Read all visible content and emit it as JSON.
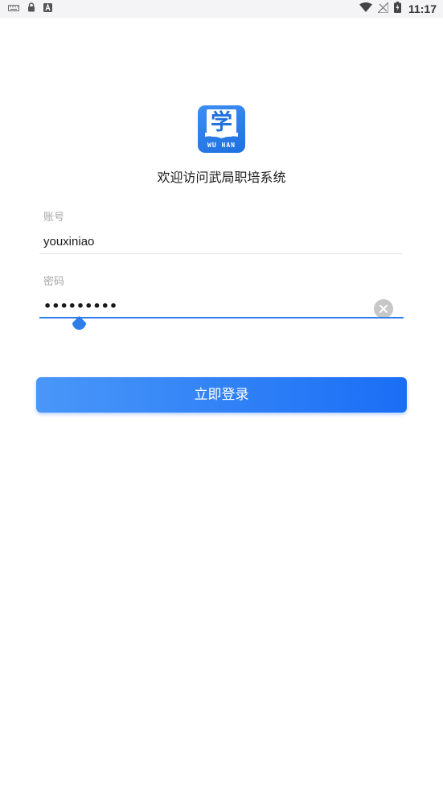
{
  "status_bar": {
    "left_icons": [
      "keyboard-icon",
      "lock-icon",
      "font-a-icon"
    ],
    "right_icons": [
      "wifi-icon",
      "no-signal-icon",
      "battery-charging-icon"
    ],
    "time": "11:17"
  },
  "logo": {
    "char": "学",
    "text": "WU HAN"
  },
  "welcome_text": "欢迎访问武局职培系统",
  "form": {
    "account_label": "账号",
    "account_value": "youxiniao",
    "password_label": "密码",
    "password_value": "•••••••••"
  },
  "login_button_label": "立即登录",
  "colors": {
    "accent": "#2f7de9",
    "button_gradient_start": "#4a97f8",
    "button_gradient_end": "#1a6ef5",
    "logo_bg": "#1f6fe0"
  }
}
